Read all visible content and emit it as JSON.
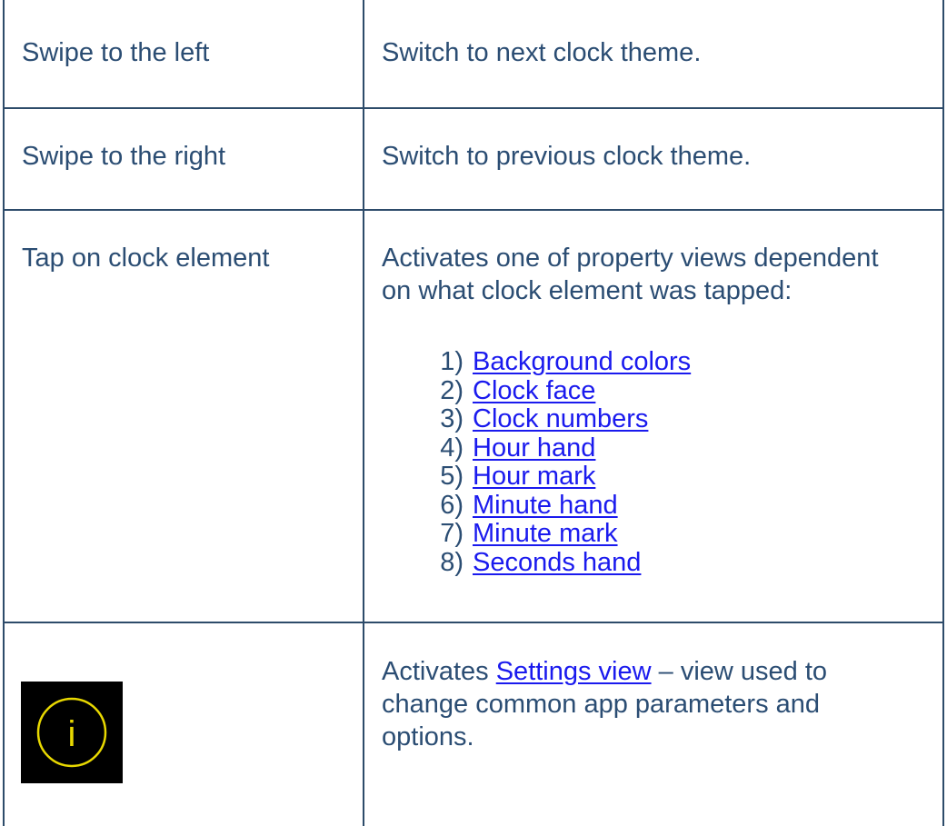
{
  "rows": [
    {
      "gesture": "Swipe to the left",
      "action": "Switch to next clock theme."
    },
    {
      "gesture": "Swipe to the right",
      "action": "Switch to previous clock theme."
    },
    {
      "gesture": "Tap on clock element",
      "action_line1": "Activates one of property views dependent",
      "action_line2": "on what clock element was tapped:",
      "list": [
        {
          "num": "1)",
          "label": "Background colors"
        },
        {
          "num": "2)",
          "label": "Clock face"
        },
        {
          "num": "3)",
          "label": "Clock numbers"
        },
        {
          "num": "4)",
          "label": "Hour hand"
        },
        {
          "num": "5)",
          "label": "Hour mark"
        },
        {
          "num": "6)",
          "label": "Minute hand"
        },
        {
          "num": "7)",
          "label": "Minute mark"
        },
        {
          "num": "8)",
          "label": "Seconds hand"
        }
      ]
    },
    {
      "icon": "info-icon",
      "icon_glyph": "i",
      "action_prefix": "Activates ",
      "action_link": "Settings view",
      "action_suffix": " – view used to",
      "action_line2": "change common app parameters and",
      "action_line3": "options."
    }
  ],
  "colors": {
    "text": "#2b4d73",
    "link": "#1a1aee",
    "border": "#2d4b6a",
    "icon_bg": "#000000",
    "icon_fg": "#e8d800"
  }
}
